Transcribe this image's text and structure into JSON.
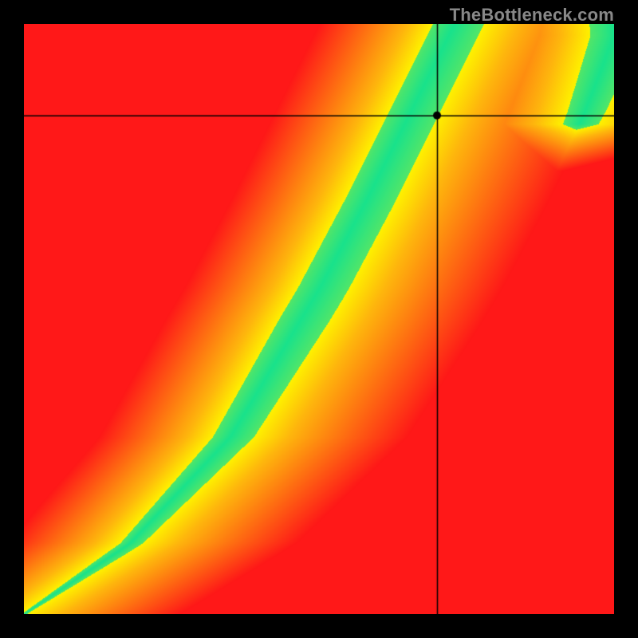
{
  "watermark": "TheBottleneck.com",
  "chart_data": {
    "type": "heatmap",
    "title": "",
    "xlabel": "",
    "ylabel": "",
    "xlim": [
      0,
      1
    ],
    "ylim": [
      0,
      1
    ],
    "crosshair": {
      "x": 0.7,
      "y": 0.845
    },
    "marker": {
      "x": 0.7,
      "y": 0.845
    },
    "curves": {
      "main_green": {
        "control_points": [
          {
            "x": 0.0,
            "y": 0.0
          },
          {
            "x": 0.18,
            "y": 0.12
          },
          {
            "x": 0.35,
            "y": 0.3
          },
          {
            "x": 0.5,
            "y": 0.55
          },
          {
            "x": 0.58,
            "y": 0.7
          },
          {
            "x": 0.63,
            "y": 0.8
          },
          {
            "x": 0.68,
            "y": 0.9
          },
          {
            "x": 0.73,
            "y": 1.0
          }
        ],
        "width_at_y": [
          {
            "y": 0.0,
            "w": 0.005
          },
          {
            "y": 0.1,
            "w": 0.02
          },
          {
            "y": 0.3,
            "w": 0.04
          },
          {
            "y": 0.5,
            "w": 0.05
          },
          {
            "y": 0.7,
            "w": 0.05
          },
          {
            "y": 0.9,
            "w": 0.05
          },
          {
            "y": 1.0,
            "w": 0.05
          }
        ]
      },
      "secondary_green": {
        "control_points": [
          {
            "x": 0.88,
            "y": 0.7
          },
          {
            "x": 0.95,
            "y": 0.85
          },
          {
            "x": 1.0,
            "y": 0.98
          }
        ],
        "width_at_y": [
          {
            "y": 0.7,
            "w": 0.0
          },
          {
            "y": 0.8,
            "w": 0.03
          },
          {
            "y": 0.9,
            "w": 0.04
          },
          {
            "y": 1.0,
            "w": 0.05
          }
        ]
      }
    },
    "colors": {
      "green": "#19e28c",
      "yellow": "#fef200",
      "orange": "#ff7a1a",
      "red": "#ff1818"
    },
    "falloff": {
      "yellow_band": 0.06,
      "orange_band": 0.2
    },
    "description": "2D heatmap; green along a curved diagonal ridge (optimal balance), transitioning through yellow to orange to red as distance from the ridge increases. A faint secondary green ridge enters at upper-right. Black crosshair lines mark a point near x=0.70, y=0.845 with a small black dot."
  }
}
